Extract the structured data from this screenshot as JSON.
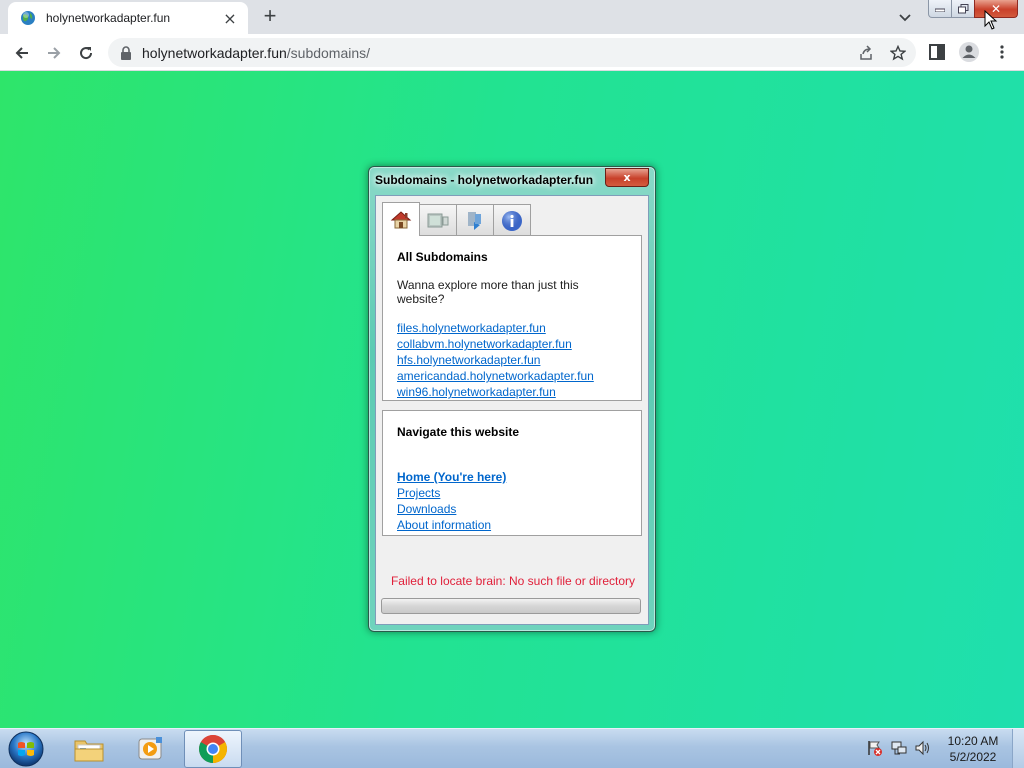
{
  "browser": {
    "tab_title": "holynetworkadapter.fun",
    "url_host": "holynetworkadapter.fun",
    "url_path": "/subdomains/"
  },
  "dialog": {
    "title": "Subdomains - holynetworkadapter.fun",
    "close_label": "x",
    "tabs": [
      "home-icon",
      "monitor-icon",
      "download-icon",
      "info-icon"
    ],
    "subdomains": {
      "heading": "All Subdomains",
      "intro": "Wanna explore more than just this website?",
      "links": [
        "files.holynetworkadapter.fun",
        "collabvm.holynetworkadapter.fun",
        "hfs.holynetworkadapter.fun",
        "americandad.holynetworkadapter.fun",
        "win96.holynetworkadapter.fun"
      ]
    },
    "navigate": {
      "heading": "Navigate this website",
      "links": [
        "Home (You're here)",
        "Projects",
        "Downloads",
        "About information"
      ]
    },
    "status": "Failed to locate brain: No such file or directory"
  },
  "taskbar": {
    "time": "10:20 AM",
    "date": "5/2/2022"
  },
  "colors": {
    "page_gradient_start": "#2ee56a",
    "page_gradient_end": "#1fdfae",
    "link": "#0066cc",
    "error": "#e0203a"
  }
}
